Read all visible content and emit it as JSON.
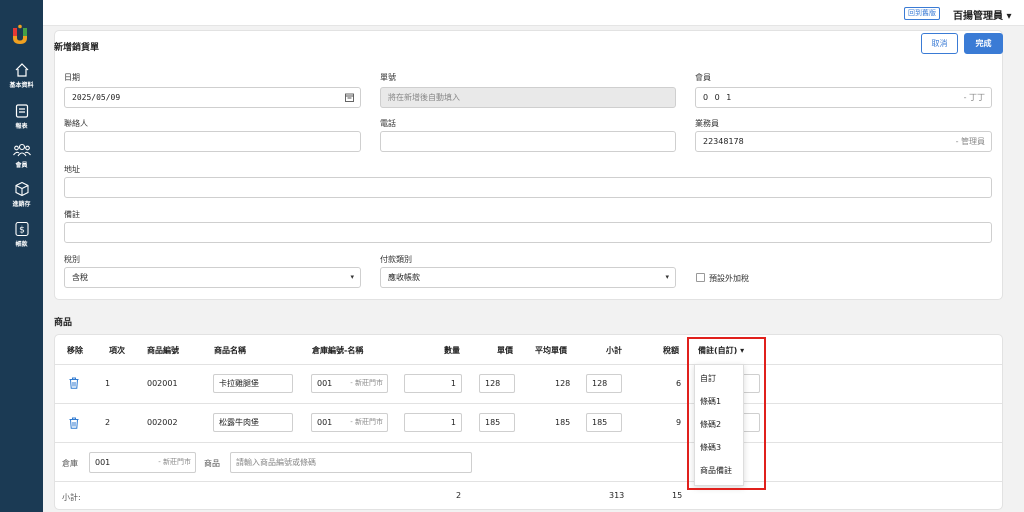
{
  "sidebar": {
    "items": [
      {
        "label": "基本資料",
        "icon": "home-icon"
      },
      {
        "label": "報表",
        "icon": "report-icon"
      },
      {
        "label": "會員",
        "icon": "members-icon"
      },
      {
        "label": "進銷存",
        "icon": "box-icon"
      },
      {
        "label": "帳款",
        "icon": "dollar-icon"
      }
    ]
  },
  "topbar": {
    "old_version_label": "回到舊版",
    "user_name": "百揚管理員 ▾"
  },
  "form": {
    "title": "新增銷貨單",
    "cancel_label": "取消",
    "done_label": "完成",
    "date_label": "日期",
    "date_value": "2025/05/09",
    "order_no_label": "單號",
    "order_no_placeholder": "將在新增後自動填入",
    "member_label": "會員",
    "member_value": "0 0 1",
    "member_suffix": "- 丁丁",
    "contact_label": "聯絡人",
    "contact_value": "",
    "phone_label": "電話",
    "phone_value": "",
    "sales_label": "業務員",
    "sales_value": "22348178",
    "sales_suffix": "- 管理員",
    "address_label": "地址",
    "address_value": "",
    "note_label": "備註",
    "note_value": "",
    "tax_label": "稅別",
    "tax_value": "含稅",
    "payment_label": "付款類別",
    "payment_value": "應收帳款",
    "default_tax_label": "預設外加稅"
  },
  "products": {
    "title": "商品",
    "headers": {
      "remove": "移除",
      "seq": "項次",
      "code": "商品編號",
      "name": "商品名稱",
      "warehouse": "倉庫編號-名稱",
      "qty": "數量",
      "price": "單價",
      "avg_price": "平均單價",
      "subtotal": "小計",
      "tax": "稅額",
      "note_custom": "備註(自訂) ▾"
    },
    "rows": [
      {
        "seq": "1",
        "code": "002001",
        "name": "卡拉雞腿堡",
        "wh_code": "001",
        "wh_name": "- 新莊門市",
        "qty": "1",
        "price": "128",
        "avg_price": "128",
        "subtotal": "128",
        "tax": "6"
      },
      {
        "seq": "2",
        "code": "002002",
        "name": "松露牛肉堡",
        "wh_code": "001",
        "wh_name": "- 新莊門市",
        "qty": "1",
        "price": "185",
        "avg_price": "185",
        "subtotal": "185",
        "tax": "9"
      }
    ],
    "add_row": {
      "warehouse_label": "倉庫",
      "warehouse_code": "001",
      "warehouse_name": "- 新莊門市",
      "product_label": "商品",
      "product_placeholder": "請輸入商品編號或條碼"
    },
    "totals": {
      "label": "小計:",
      "qty": "2",
      "subtotal": "313",
      "tax": "15"
    }
  },
  "note_dropdown": {
    "options": [
      "自訂",
      "條碼1",
      "條碼2",
      "條碼3",
      "商品備註"
    ]
  }
}
